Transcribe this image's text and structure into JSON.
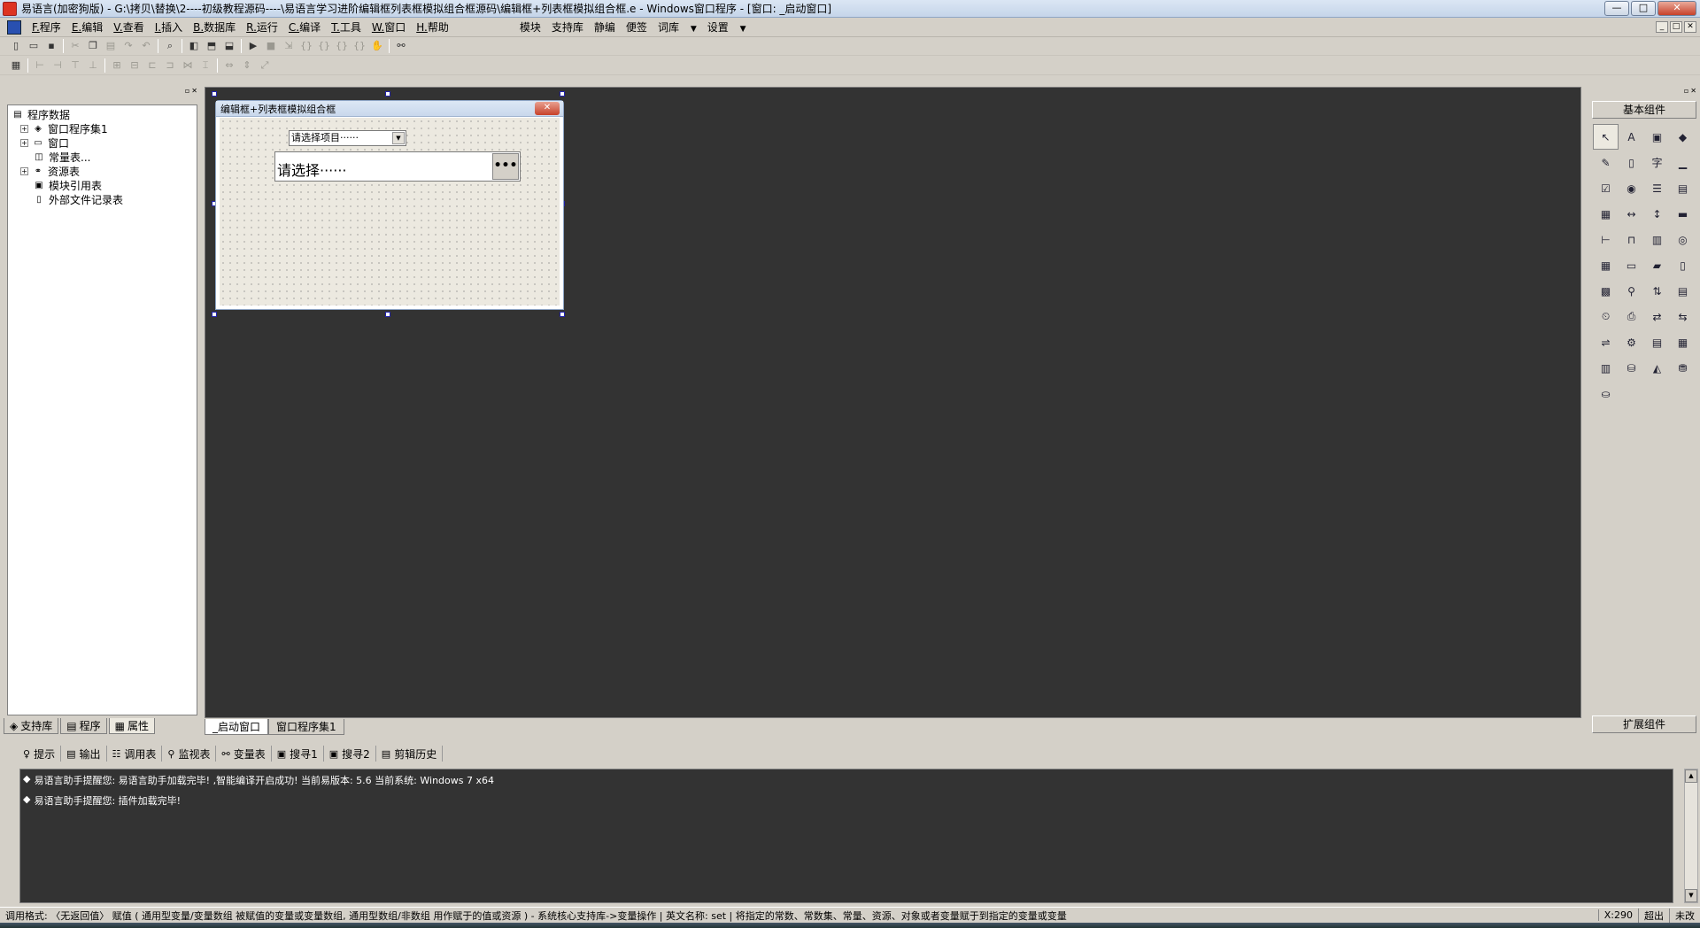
{
  "titlebar": {
    "title": "易语言(加密狗版) - G:\\拷贝\\替换\\2----初级教程源码----\\易语言学习进阶编辑框列表框模拟组合框源码\\编辑框+列表框模拟组合框.e - Windows窗口程序 - [窗口: _启动窗口]",
    "btn_min": "—",
    "btn_max": "□",
    "btn_close": "✕"
  },
  "menubar": {
    "items": [
      {
        "key": "F.",
        "label": "程序"
      },
      {
        "key": "E.",
        "label": "编辑"
      },
      {
        "key": "V.",
        "label": "查看"
      },
      {
        "key": "I.",
        "label": "插入"
      },
      {
        "key": "B.",
        "label": "数据库"
      },
      {
        "key": "R.",
        "label": "运行"
      },
      {
        "key": "C.",
        "label": "编译"
      },
      {
        "key": "T.",
        "label": "工具"
      },
      {
        "key": "W.",
        "label": "窗口"
      },
      {
        "key": "H.",
        "label": "帮助"
      }
    ],
    "extras": [
      "模块",
      "支持库",
      "静编",
      "便签",
      "词库",
      "设置"
    ],
    "mdi_min": "_",
    "mdi_max": "□",
    "mdi_close": "✕"
  },
  "left_panel": {
    "tree": [
      {
        "label": "程序数据",
        "level": 0
      },
      {
        "label": "窗口程序集1",
        "level": 1,
        "expand": "+"
      },
      {
        "label": "窗口",
        "level": 1,
        "expand": "+"
      },
      {
        "label": "常量表...",
        "level": 2
      },
      {
        "label": "资源表",
        "level": 1,
        "expand": "+"
      },
      {
        "label": "模块引用表",
        "level": 2
      },
      {
        "label": "外部文件记录表",
        "level": 2
      }
    ],
    "tabs": [
      "支持库",
      "程序",
      "属性"
    ]
  },
  "form_designer": {
    "window_title": "编辑框+列表框模拟组合框",
    "combo_value": "请选择项目······",
    "edit_value": "请选择······",
    "edit_button": "•••",
    "close": "✕"
  },
  "canvas_tabs": [
    "_启动窗口",
    "窗口程序集1"
  ],
  "right_panel": {
    "header": "基本组件",
    "footer": "扩展组件"
  },
  "bottom_panel": {
    "tabs": [
      "提示",
      "输出",
      "调用表",
      "监视表",
      "变量表",
      "搜寻1",
      "搜寻2",
      "剪辑历史"
    ],
    "output_lines": [
      "易语言助手提醒您: 易语言助手加载完毕!  ,智能编译开启成功!  当前易版本: 5.6  当前系统: Windows 7 x64",
      "易语言助手提醒您: 插件加载完毕!"
    ]
  },
  "statusbar": {
    "main": "调用格式:  〈无返回值〉 赋值 ( 通用型变量/变量数组 被赋值的变量或变量数组, 通用型数组/非数组 用作赋于的值或资源 ) - 系统核心支持库->变量操作  |  英文名称: set  |  将指定的常数、常数集、常量、资源、对象或者变量赋于到指定的变量或变量",
    "coord": "X:290",
    "mode": "超出",
    "state": "未改"
  }
}
